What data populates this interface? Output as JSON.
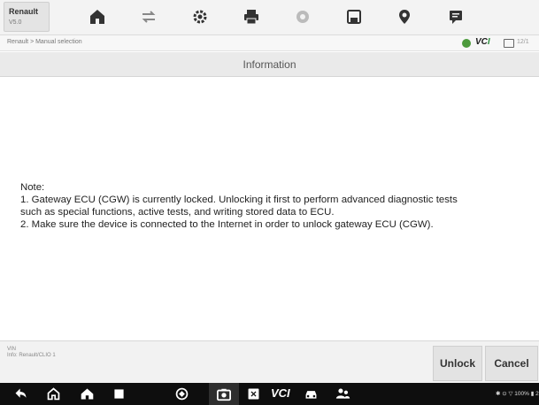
{
  "toolbar": {
    "brand_name": "Renault",
    "brand_version": "V5.0",
    "icons": [
      "home-icon",
      "vehicle-swap-icon",
      "settings-icon",
      "print-icon",
      "help-icon",
      "save-icon",
      "location-icon",
      "feedback-icon"
    ]
  },
  "breadcrumb": {
    "path": "Renault > Manual selection"
  },
  "status": {
    "vci_label": "VC",
    "vci_label_suffix": "I",
    "date_fragment": "12/1"
  },
  "dialog": {
    "title": "Information",
    "note_heading": "Note:",
    "note_line1": "1. Gateway ECU (CGW) is currently locked. Unlocking it first to perform advanced diagnostic tests",
    "note_line2": "such as special functions, active tests, and writing stored data to ECU.",
    "note_line3": "2. Make sure the device is connected to the Internet in order to unlock gateway ECU (CGW)."
  },
  "footer": {
    "vin_label": "VIN",
    "vehicle_path": "Info: Renault/CLIO 1",
    "unlock_label": "Unlock",
    "cancel_label": "Cancel"
  },
  "navbar": {
    "vci_text": "VCI",
    "status_text": "✱ ⊙ ▽ 100% ▮ 22:58"
  },
  "colors": {
    "toolbar_bg": "#f3f3f3",
    "header_bg": "#eaeaea",
    "navbar_bg": "#0e0e0e",
    "vci_green": "#2c8f3c"
  }
}
